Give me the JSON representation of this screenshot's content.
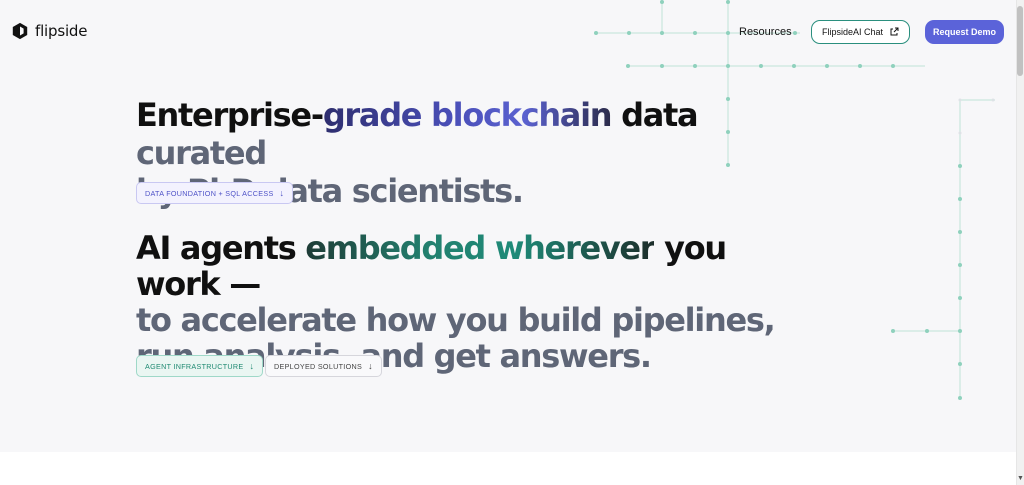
{
  "nav": {
    "logo_text": "flipside",
    "resources_label": "Resources",
    "chat_button_label": "FlipsideAI Chat",
    "demo_button_label": "Request Demo"
  },
  "hero": {
    "headline1": {
      "part1": "Enterprise-",
      "part2": "grade blockchain",
      "part3": " data ",
      "part4": "curated",
      "part5": "by PhD data scientists."
    },
    "tag1_label": "DATA FOUNDATION + SQL ACCESS",
    "headline2": {
      "part1": "AI agents ",
      "part2": "embedded wherever",
      "part3": " you work —",
      "part4": "to accelerate how you build pipelines, run analysis, and get answers."
    },
    "tag2_label": "AGENT INFRASTRUCTURE",
    "tag3_label": "DEPLOYED SOLUTIONS"
  },
  "icons": {
    "logo": "flipside-logo-icon",
    "external": "external-link-icon",
    "arrow": "arrow-down-icon"
  },
  "colors": {
    "accent_purple": "#5b63d9",
    "accent_green": "#2a8f7e",
    "muted_text": "#5f6677"
  }
}
